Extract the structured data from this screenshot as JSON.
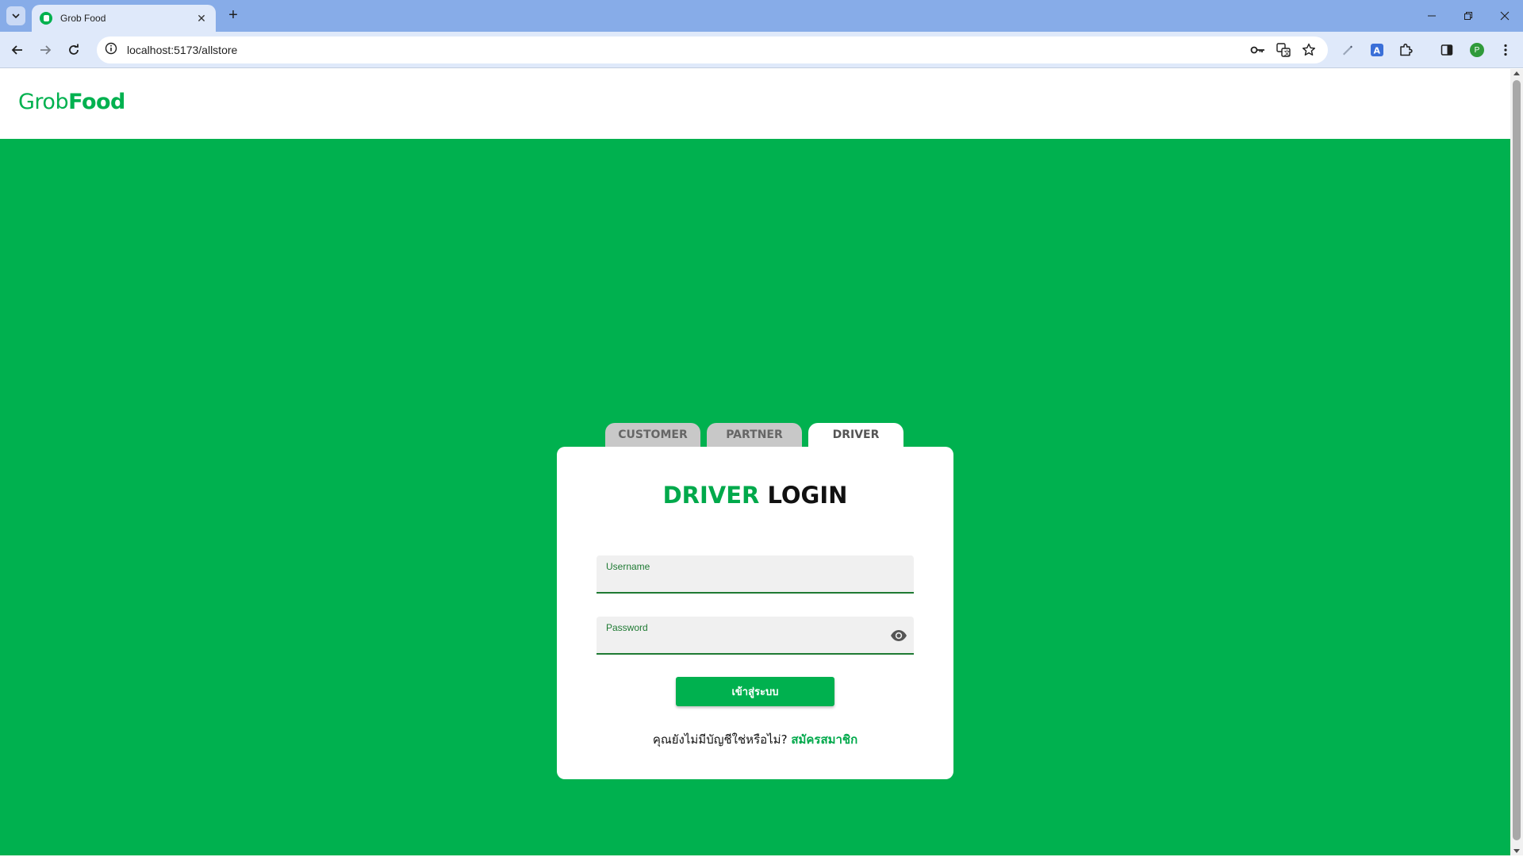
{
  "browser": {
    "tab_title": "Grob Food",
    "url": "localhost:5173/allstore",
    "profile_initial": "P",
    "icons": [
      "tab-list-icon",
      "favicon",
      "close-icon",
      "new-tab-icon",
      "minimize-icon",
      "restore-icon",
      "window-close-icon",
      "back-icon",
      "forward-icon",
      "reload-icon",
      "site-info-icon",
      "password-key-icon",
      "translate-icon",
      "bookmark-star-icon",
      "pen-icon",
      "extension-a-icon",
      "extensions-puzzle-icon",
      "side-panel-icon",
      "profile-avatar",
      "menu-kebab-icon"
    ]
  },
  "header": {
    "logo_part1": "Grob",
    "logo_part2": "Food"
  },
  "role_tabs": [
    {
      "label": "CUSTOMER",
      "active": false
    },
    {
      "label": "PARTNER",
      "active": false
    },
    {
      "label": "DRIVER",
      "active": true
    }
  ],
  "login": {
    "title_highlight": "DRIVER",
    "title_rest": " LOGIN",
    "username_label": "Username",
    "username_value": "",
    "password_label": "Password",
    "password_value": "",
    "submit_label": "เข้าสู่ระบบ",
    "signup_prompt": "คุณยังไม่มีบัญชีใช่หรือไม่? ",
    "signup_link": "สมัครสมาชิก"
  },
  "colors": {
    "brand_green": "#00b14f",
    "title_green": "#00a94b",
    "field_underline": "#1f7a33",
    "chrome_tabbar": "#87ace8",
    "chrome_toolbar": "#dfe9fa"
  }
}
